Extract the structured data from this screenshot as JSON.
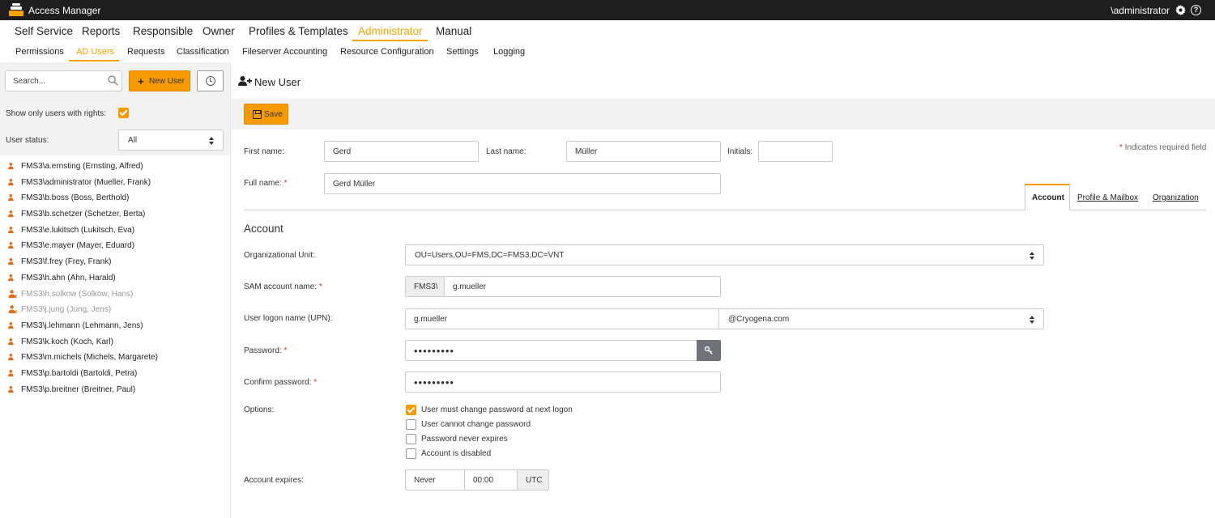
{
  "app": {
    "title": "Access Manager",
    "user": "\\administrator",
    "help_glyph": "?"
  },
  "main_nav": [
    {
      "label": "Self Service"
    },
    {
      "label": "Reports"
    },
    {
      "label": "Responsible"
    },
    {
      "label": "Owner"
    },
    {
      "label": "Profiles & Templates"
    },
    {
      "label": "Administrator",
      "active": true
    },
    {
      "label": "Manual"
    }
  ],
  "sub_nav": [
    {
      "label": "Permissions"
    },
    {
      "label": "AD Users",
      "active": true
    },
    {
      "label": "Requests"
    },
    {
      "label": "Classification"
    },
    {
      "label": "Fileserver Accounting"
    },
    {
      "label": "Resource Configuration"
    },
    {
      "label": "Settings"
    },
    {
      "label": "Logging"
    }
  ],
  "sidebar": {
    "search_placeholder": "Search...",
    "new_user_label": "New User",
    "plus_glyph": "+",
    "show_only_label": "Show only users with rights:",
    "show_only_checked": true,
    "status_label": "User status:",
    "status_value": "All",
    "users": [
      {
        "name": "FMS3\\a.ernsting (Ernsting, Alfred)",
        "disabled": false
      },
      {
        "name": "FMS3\\administrator (Mueller, Frank)",
        "disabled": false
      },
      {
        "name": "FMS3\\b.boss (Boss, Berthold)",
        "disabled": false
      },
      {
        "name": "FMS3\\b.schetzer (Schetzer, Berta)",
        "disabled": false
      },
      {
        "name": "FMS3\\e.lukitsch (Lukitsch, Eva)",
        "disabled": false
      },
      {
        "name": "FMS3\\e.mayer (Mayer, Eduard)",
        "disabled": false
      },
      {
        "name": "FMS3\\f.frey (Frey, Frank)",
        "disabled": false
      },
      {
        "name": "FMS3\\h.ahn (Ahn, Harald)",
        "disabled": false
      },
      {
        "name": "FMS3\\h.solkow (Solkow, Hans)",
        "disabled": true
      },
      {
        "name": "FMS3\\j.jung (Jung, Jens)",
        "disabled": true
      },
      {
        "name": "FMS3\\j.lehmann (Lehmann, Jens)",
        "disabled": false
      },
      {
        "name": "FMS3\\k.koch (Koch, Karl)",
        "disabled": false
      },
      {
        "name": "FMS3\\m.michels (Michels, Margarete)",
        "disabled": false
      },
      {
        "name": "FMS3\\p.bartoldi (Bartoldi, Petra)",
        "disabled": false
      },
      {
        "name": "FMS3\\p.breitner (Breitner, Paul)",
        "disabled": false
      }
    ]
  },
  "page": {
    "title": "New User",
    "save_label": "Save",
    "required_note_star": "*",
    "required_note": " Indicates required field",
    "required_star": " *",
    "first_name_label": "First name:",
    "first_name": "Gerd",
    "last_name_label": "Last name:",
    "last_name": "Müller",
    "initials_label": "Initials:",
    "initials": "",
    "full_name_label": "Full name:",
    "full_name": "Gerd Müller",
    "tabs": [
      {
        "label": "Account",
        "active": true
      },
      {
        "label": "Profile & Mailbox"
      },
      {
        "label": "Organization"
      }
    ],
    "account": {
      "section_title": "Account",
      "ou_label": "Organizational Unit:",
      "ou_value": "OU=Users,OU=FMS,DC=FMS3,DC=VNT",
      "sam_label": "SAM account name:",
      "sam_prefix": "FMS3\\",
      "sam_value": "g.mueller",
      "upn_label": "User logon name (UPN):",
      "upn_value": "g.mueller",
      "upn_domain": "@Cryogena.com",
      "password_label": "Password:",
      "password_value": "secretpwd",
      "confirm_label": "Confirm password:",
      "confirm_value": "secretpwd",
      "options_label": "Options:",
      "options": [
        {
          "label": "User must change password at next logon",
          "checked": true
        },
        {
          "label": "User cannot change password",
          "checked": false
        },
        {
          "label": "Password never expires",
          "checked": false
        },
        {
          "label": "Account is disabled",
          "checked": false
        }
      ],
      "expires_label": "Account expires:",
      "expires_date": "Never",
      "expires_time": "00:00",
      "expires_tz": "UTC"
    }
  },
  "colors": {
    "accent": "#f59b00",
    "titlebar": "#1e1e1e",
    "required": "#e0301e"
  }
}
